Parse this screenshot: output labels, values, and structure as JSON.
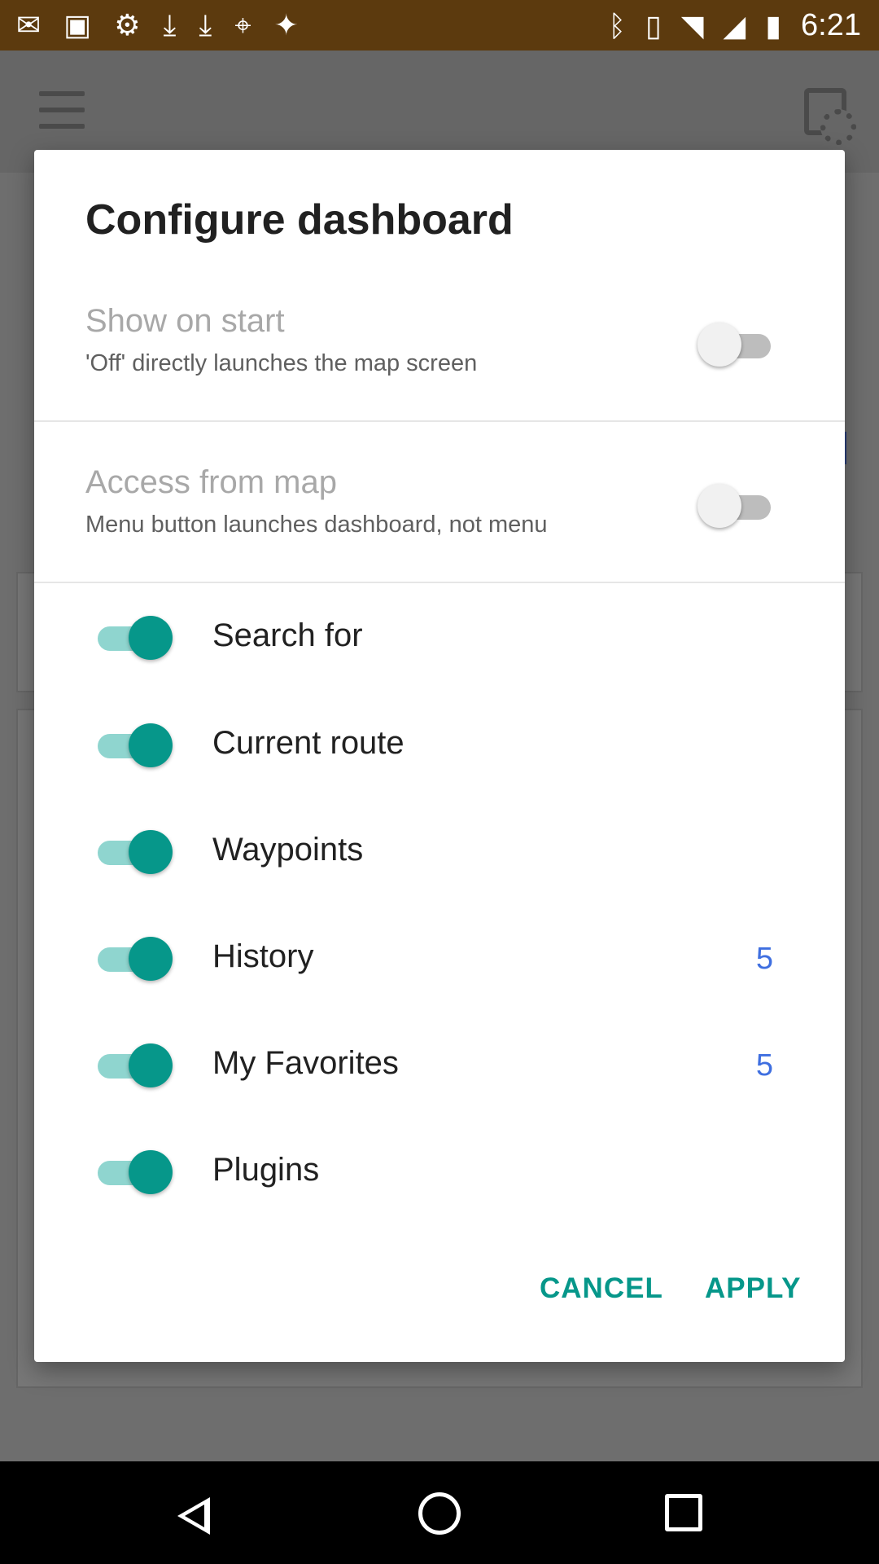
{
  "status_bar": {
    "time": "6:21",
    "left_icons": [
      "mail-icon",
      "photo-icon",
      "settings-icon",
      "download-icon",
      "download-icon",
      "fake-gps-icon",
      "satellite-icon"
    ],
    "right_icons": [
      "bluetooth-icon",
      "vibrate-icon",
      "wifi-icon",
      "signal-icon",
      "battery-icon"
    ]
  },
  "dialog": {
    "title": "Configure dashboard",
    "preferences": [
      {
        "title": "Show on start",
        "summary": "'Off' directly launches the map screen",
        "enabled": false
      },
      {
        "title": "Access from map",
        "summary": "Menu button launches dashboard, not menu",
        "enabled": false
      }
    ],
    "items": [
      {
        "label": "Search for",
        "count": "",
        "enabled": true
      },
      {
        "label": "Current route",
        "count": "",
        "enabled": true
      },
      {
        "label": "Waypoints",
        "count": "",
        "enabled": true
      },
      {
        "label": "History",
        "count": "5",
        "enabled": true
      },
      {
        "label": "My Favorites",
        "count": "5",
        "enabled": true
      },
      {
        "label": "Plugins",
        "count": "",
        "enabled": true
      }
    ],
    "cancel_label": "CANCEL",
    "apply_label": "APPLY"
  },
  "colors": {
    "accent": "#06978a",
    "count": "#3f6fe0",
    "status_bar": "#5c3a0e"
  }
}
